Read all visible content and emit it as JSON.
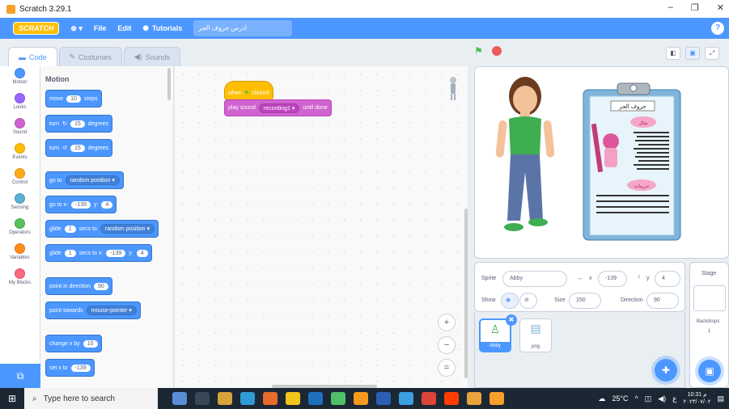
{
  "window": {
    "title": "Scratch 3.29.1",
    "minimize": "–",
    "maximize": "❐",
    "close": "✕"
  },
  "menubar": {
    "logo": "SCRATCH",
    "globe": "⊕ ▾",
    "file": "File",
    "edit": "Edit",
    "tutorials": "Tutorials",
    "project_title": "ادرس حروف الجر",
    "help": "?"
  },
  "tabs": [
    {
      "label": "Code"
    },
    {
      "label": "Costumes"
    },
    {
      "label": "Sounds"
    }
  ],
  "categories": [
    {
      "label": "Motion",
      "color": "#4c97ff"
    },
    {
      "label": "Looks",
      "color": "#9966ff"
    },
    {
      "label": "Sound",
      "color": "#cf63cf"
    },
    {
      "label": "Events",
      "color": "#ffbf00"
    },
    {
      "label": "Control",
      "color": "#ffab19"
    },
    {
      "label": "Sensing",
      "color": "#5cb1d6"
    },
    {
      "label": "Operators",
      "color": "#59c059"
    },
    {
      "label": "Variables",
      "color": "#ff8c1a"
    },
    {
      "label": "My Blocks",
      "color": "#ff6680"
    }
  ],
  "palette": {
    "title": "Motion",
    "move": {
      "pre": "move",
      "val": "10",
      "post": "steps"
    },
    "turn_right": {
      "pre": "turn",
      "icon": "↻",
      "val": "15",
      "post": "degrees"
    },
    "turn_left": {
      "pre": "turn",
      "icon": "↺",
      "val": "15",
      "post": "degrees"
    },
    "goto": {
      "pre": "go to",
      "dd": "random position ▾"
    },
    "goto_xy": {
      "pre": "go to x:",
      "x": "-139",
      "mid": "y:",
      "y": "4"
    },
    "glide_to": {
      "pre": "glide",
      "val": "1",
      "mid": "secs to",
      "dd": "random position ▾"
    },
    "glide_xy": {
      "pre": "glide",
      "val": "1",
      "mid": "secs to x:",
      "x": "-139",
      "mid2": "y:",
      "y": "4"
    },
    "point_dir": {
      "pre": "point in direction",
      "val": "90"
    },
    "point_towards": {
      "pre": "point towards",
      "dd": "mouse-pointer ▾"
    },
    "change_x": {
      "pre": "change x by",
      "val": "10"
    },
    "set_x": {
      "pre": "set x to",
      "val": "-139"
    }
  },
  "script": {
    "hat": {
      "pre": "when",
      "flag": "⚑",
      "post": "clicked"
    },
    "sound": {
      "pre": "play sound",
      "dd": "recording1 ▾",
      "post": "until done"
    }
  },
  "zoom": {
    "in": "+",
    "out": "−",
    "reset": "="
  },
  "stage_controls": {
    "flag": "⚑"
  },
  "stage_card": {
    "title": "حروف الجر",
    "example_heading": "مثال",
    "exercise_heading": "تدريبات"
  },
  "sprite_info": {
    "sprite_label": "Sprite",
    "sprite_name": "Abby",
    "x_label": "x",
    "x": "-139",
    "y_label": "y",
    "y": "4",
    "show_label": "Show",
    "size_label": "Size",
    "size": "150",
    "direction_label": "Direction",
    "direction": "90"
  },
  "sprites": [
    {
      "name": "Abby"
    },
    {
      "name": "png"
    }
  ],
  "stage_pane": {
    "label": "Stage",
    "backdrops_label": "Backdrops",
    "backdrops_count": "1"
  },
  "taskbar": {
    "search_placeholder": "Type here to search",
    "temperature": "25°C",
    "lang": "ع",
    "time": "10:31 م",
    "date": "٢٠٢٣/٠٧/٠٢"
  }
}
